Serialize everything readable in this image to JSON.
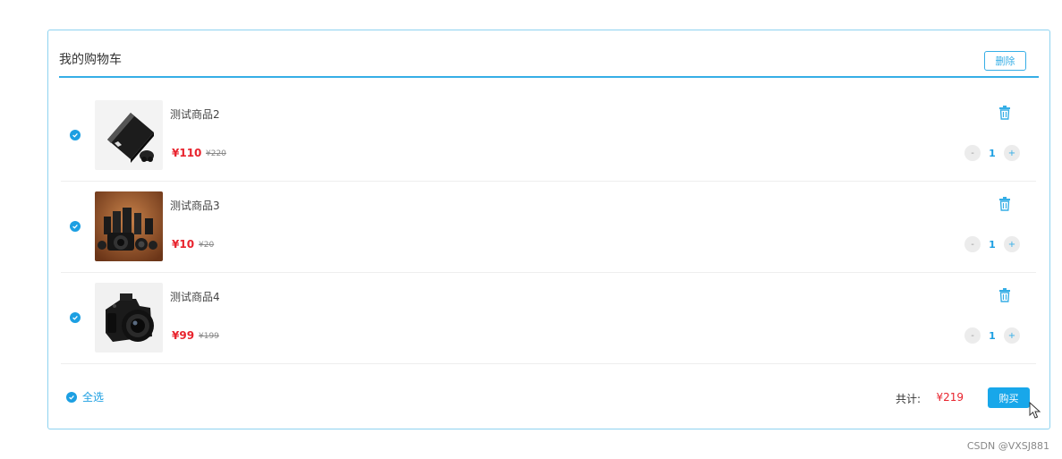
{
  "cart": {
    "title": "我的购物车",
    "delete_label": "删除"
  },
  "items": [
    {
      "name": "测试商品2",
      "price": "¥110",
      "old_price": "¥220",
      "quantity": "1",
      "image": "game-console",
      "checked": true
    },
    {
      "name": "测试商品3",
      "price": "¥10",
      "old_price": "¥20",
      "quantity": "1",
      "image": "camera-lenses",
      "checked": true
    },
    {
      "name": "测试商品4",
      "price": "¥99",
      "old_price": "¥199",
      "quantity": "1",
      "image": "dslr-camera",
      "checked": true
    }
  ],
  "controls": {
    "minus": "-",
    "plus": "+"
  },
  "footer": {
    "select_all_label": "全选",
    "total_label": "共计:",
    "total_value": "¥219",
    "buy_label": "购买"
  },
  "watermark": "CSDN @VXSJ881",
  "colors": {
    "accent": "#1c9fe2",
    "price": "#e8232d",
    "border": "#8fd3f0"
  },
  "icons": {
    "check": "check-circle-icon",
    "trash": "trash-icon",
    "cursor": "mouse-cursor-icon"
  }
}
